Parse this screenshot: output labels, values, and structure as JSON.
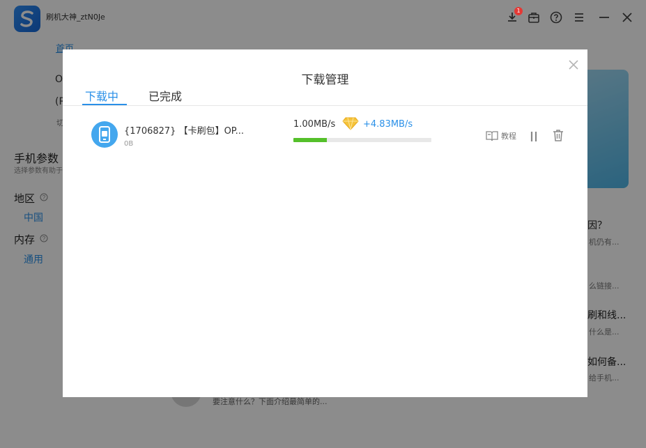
{
  "app": {
    "title": "刷机大神_ztN0Je",
    "download_badge": "1",
    "nav_home": "首页",
    "model_line1": "O",
    "model_line2": "(R",
    "model_line3": "切",
    "phone_params_title": "手机参数",
    "phone_params_subtitle": "选择参数有助于",
    "region_label": "地区",
    "region_value": "中国",
    "storage_label": "内存",
    "storage_value": "通用",
    "articles": [
      {
        "title": "因？",
        "snippet": "机仍有..."
      },
      {
        "title": "",
        "snippet": "么链接..."
      },
      {
        "title": "刷和线...",
        "snippet": "什么是..."
      },
      {
        "title": "如何备...",
        "snippet": "给手机..."
      }
    ],
    "bottom_snippet": "要注意什么？下面介绍最简单的...",
    "colors": {
      "brand": "#2a90e8",
      "progress": "#55c02b",
      "badge": "#e53935"
    }
  },
  "dialog": {
    "title": "下载管理",
    "tabs": [
      {
        "label": "下载中",
        "active": true
      },
      {
        "label": "已完成",
        "active": false
      }
    ],
    "downloads": [
      {
        "name": "{1706827} 【卡刷包】OP...",
        "size": "0B",
        "speed": "1.00MB/s",
        "boost": "+4.83MB/s",
        "progress": 0.24,
        "tutorial_label": "教程",
        "icon": "phone-package-icon"
      }
    ]
  }
}
